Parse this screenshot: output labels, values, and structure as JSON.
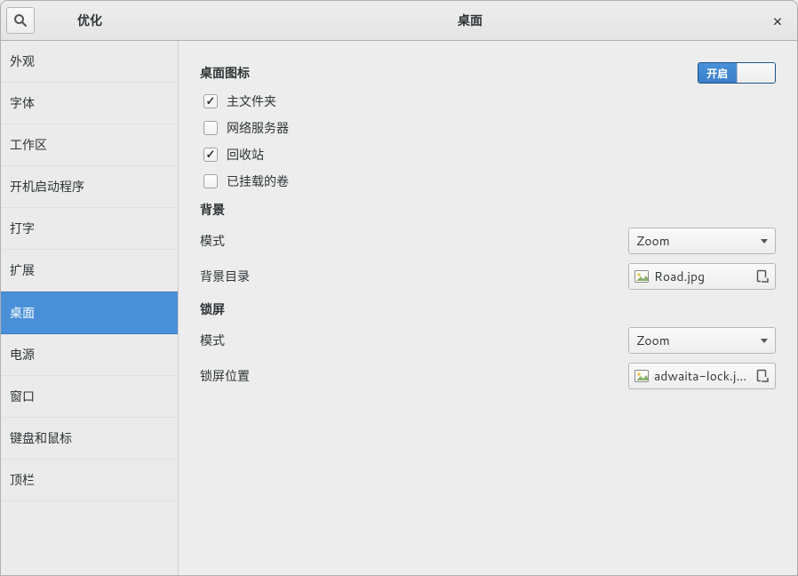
{
  "header": {
    "app_title": "优化",
    "page_title": "桌面"
  },
  "sidebar": {
    "items": [
      {
        "label": "外观"
      },
      {
        "label": "字体"
      },
      {
        "label": "工作区"
      },
      {
        "label": "开机启动程序"
      },
      {
        "label": "打字"
      },
      {
        "label": "扩展"
      },
      {
        "label": "桌面",
        "selected": true
      },
      {
        "label": "电源"
      },
      {
        "label": "窗口"
      },
      {
        "label": "键盘和鼠标"
      },
      {
        "label": "顶栏"
      }
    ]
  },
  "desktop_icons": {
    "title": "桌面图标",
    "switch_label": "开启",
    "switch_state": true,
    "options": [
      {
        "label": "主文件夹",
        "checked": true
      },
      {
        "label": "网络服务器",
        "checked": false
      },
      {
        "label": "回收站",
        "checked": true
      },
      {
        "label": "已挂载的卷",
        "checked": false
      }
    ]
  },
  "background": {
    "title": "背景",
    "mode_label": "模式",
    "mode_value": "Zoom",
    "dir_label": "背景目录",
    "dir_file": "Road.jpg"
  },
  "lockscreen": {
    "title": "锁屏",
    "mode_label": "模式",
    "mode_value": "Zoom",
    "pos_label": "锁屏位置",
    "pos_file": "adwaita-lock.jpg"
  }
}
